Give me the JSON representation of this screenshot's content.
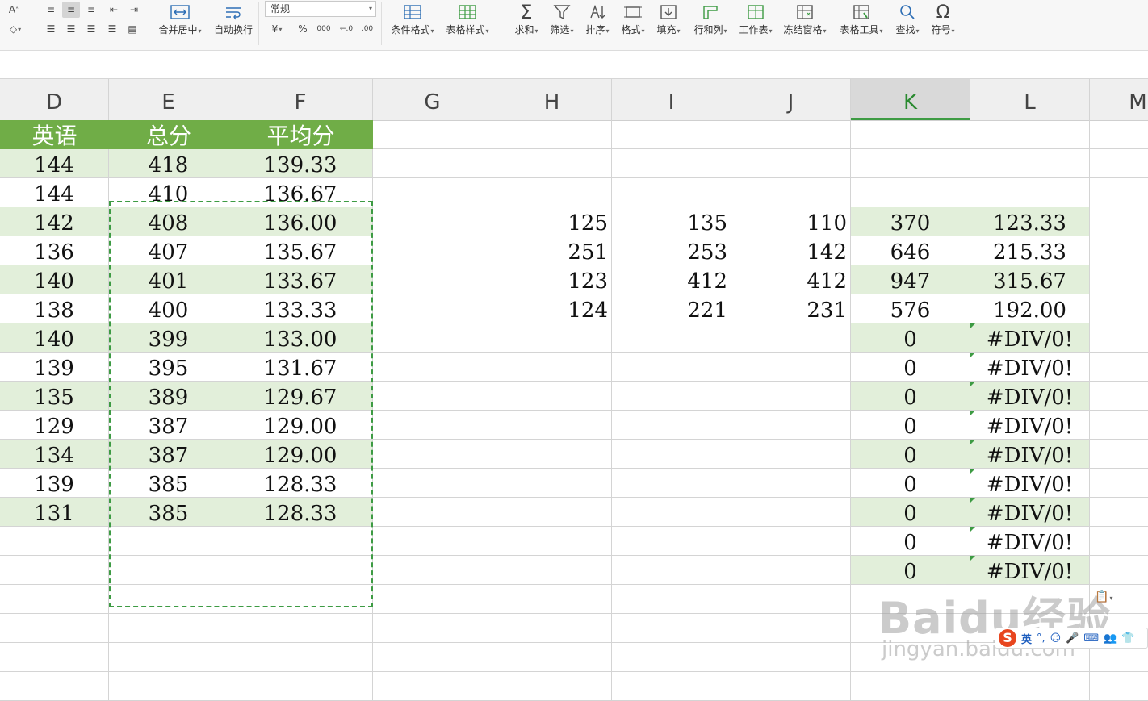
{
  "ribbon": {
    "tools": [
      {
        "id": "merge-center",
        "label": "合并居中",
        "icon": "merge-center-icon"
      },
      {
        "id": "wrap-text",
        "label": "自动换行",
        "icon": "wrap-text-icon"
      },
      {
        "id": "conditional-format",
        "label": "条件格式",
        "icon": "conditional-format-icon"
      },
      {
        "id": "table-style",
        "label": "表格样式",
        "icon": "table-style-icon"
      },
      {
        "id": "sum",
        "label": "求和",
        "icon": "sigma-icon"
      },
      {
        "id": "filter",
        "label": "筛选",
        "icon": "funnel-icon"
      },
      {
        "id": "sort",
        "label": "排序",
        "icon": "sort-icon"
      },
      {
        "id": "format",
        "label": "格式",
        "icon": "format-icon"
      },
      {
        "id": "fill",
        "label": "填充",
        "icon": "fill-down-icon"
      },
      {
        "id": "row-col",
        "label": "行和列",
        "icon": "row-col-icon"
      },
      {
        "id": "worksheet",
        "label": "工作表",
        "icon": "worksheet-icon"
      },
      {
        "id": "freeze",
        "label": "冻结窗格",
        "icon": "freeze-pane-icon"
      },
      {
        "id": "table-tools",
        "label": "表格工具",
        "icon": "table-tools-icon"
      },
      {
        "id": "find",
        "label": "查找",
        "icon": "magnifier-icon"
      },
      {
        "id": "symbol",
        "label": "符号",
        "icon": "omega-icon"
      }
    ],
    "number_format": "常规",
    "number_buttons": [
      "¥",
      "%",
      "000",
      "←.0",
      ".00"
    ]
  },
  "columns": [
    "D",
    "E",
    "F",
    "G",
    "H",
    "I",
    "J",
    "K",
    "L",
    "M"
  ],
  "selected_column": "K",
  "header_row": [
    "英语",
    "总分",
    "平均分"
  ],
  "rows": [
    {
      "D": "144",
      "E": "418",
      "F": "139.33"
    },
    {
      "D": "144",
      "E": "410",
      "F": "136.67"
    },
    {
      "D": "142",
      "E": "408",
      "F": "136.00",
      "H": "125",
      "I": "135",
      "J": "110",
      "K": "370",
      "L": "123.33"
    },
    {
      "D": "136",
      "E": "407",
      "F": "135.67",
      "H": "251",
      "I": "253",
      "J": "142",
      "K": "646",
      "L": "215.33"
    },
    {
      "D": "140",
      "E": "401",
      "F": "133.67",
      "H": "123",
      "I": "412",
      "J": "412",
      "K": "947",
      "L": "315.67"
    },
    {
      "D": "138",
      "E": "400",
      "F": "133.33",
      "H": "124",
      "I": "221",
      "J": "231",
      "K": "576",
      "L": "192.00"
    },
    {
      "D": "140",
      "E": "399",
      "F": "133.00",
      "K": "0",
      "L": "#DIV/0!"
    },
    {
      "D": "139",
      "E": "395",
      "F": "131.67",
      "K": "0",
      "L": "#DIV/0!"
    },
    {
      "D": "135",
      "E": "389",
      "F": "129.67",
      "K": "0",
      "L": "#DIV/0!"
    },
    {
      "D": "129",
      "E": "387",
      "F": "129.00",
      "K": "0",
      "L": "#DIV/0!"
    },
    {
      "D": "134",
      "E": "387",
      "F": "129.00",
      "K": "0",
      "L": "#DIV/0!"
    },
    {
      "D": "139",
      "E": "385",
      "F": "128.33",
      "K": "0",
      "L": "#DIV/0!"
    },
    {
      "D": "131",
      "E": "385",
      "F": "128.33",
      "K": "0",
      "L": "#DIV/0!"
    },
    {
      "K": "0",
      "L": "#DIV/0!"
    },
    {
      "K": "0",
      "L": "#DIV/0!"
    },
    {},
    {},
    {},
    {}
  ],
  "ime": {
    "mode": "英"
  },
  "watermark": {
    "brand": "Baidu经验",
    "url": "jingyan.baidu.com"
  },
  "colors": {
    "header_green": "#70ad47",
    "band_green": "#e2efda",
    "accent_green": "#3d9b43"
  }
}
